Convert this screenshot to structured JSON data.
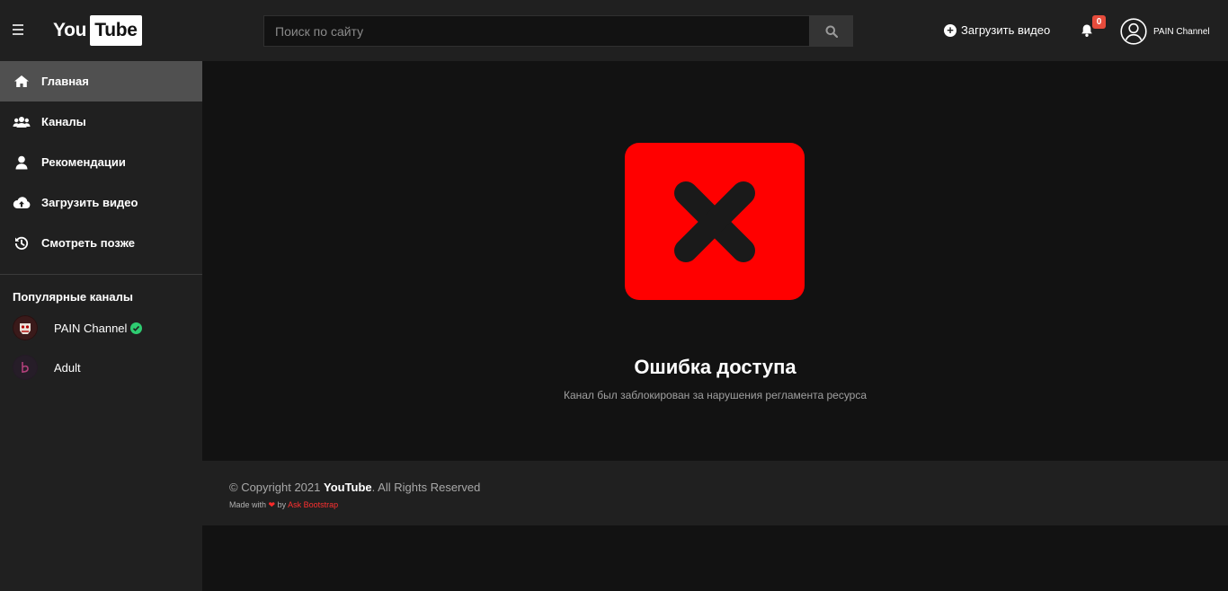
{
  "header": {
    "logo_you": "You",
    "logo_tube": "Tube",
    "search_placeholder": "Поиск по сайту",
    "upload_label": "Загрузить видео",
    "notification_count": "0",
    "user_name": "PAIN Channel"
  },
  "sidebar": {
    "items": [
      {
        "label": "Главная",
        "icon": "home-icon",
        "active": true
      },
      {
        "label": "Каналы",
        "icon": "users-icon",
        "active": false
      },
      {
        "label": "Рекомендации",
        "icon": "user-icon",
        "active": false
      },
      {
        "label": "Загрузить видео",
        "icon": "cloud-upload-icon",
        "active": false
      },
      {
        "label": "Смотреть позже",
        "icon": "history-icon",
        "active": false
      }
    ],
    "popular_title": "Популярные каналы",
    "channels": [
      {
        "name": "PAIN Channel",
        "verified": true
      },
      {
        "name": "Adult",
        "verified": false
      }
    ]
  },
  "main": {
    "error_icon": "close-x-icon",
    "error_title": "Ошибка доступа",
    "error_subtitle": "Канал был заблокирован за нарушения регламента ресурса"
  },
  "footer": {
    "copyright_prefix": "© Copyright 2021",
    "brand": "YouTube",
    "copyright_suffix": ". All Rights Reserved",
    "made_with": "Made with",
    "by": "by",
    "author": "Ask Bootstrap"
  },
  "colors": {
    "accent": "#ff0000",
    "header_bg": "#202020",
    "body_bg": "#121212",
    "active_nav": "#505050",
    "verified": "#2ecc71"
  }
}
